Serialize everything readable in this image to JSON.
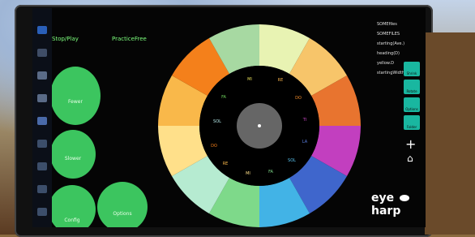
{
  "menu": {
    "stop_play": "Stop/Play",
    "practice_free": "PracticeFree"
  },
  "buttons": {
    "fewer": "Fewer",
    "slower": "Slower",
    "config": "Config",
    "options": "Options"
  },
  "wheel": {
    "inner_labels": [
      "FA",
      "MI",
      "RE",
      "DO",
      "TI",
      "LA",
      "SOL",
      "FA",
      "MI",
      "RE",
      "DO",
      "SOL"
    ],
    "colors": [
      "#b3e6e6",
      "#a7d9a2",
      "#e8f3b3",
      "#f7c56a",
      "#e8742f",
      "#c23fbf",
      "#3f66cc",
      "#42b3e6",
      "#7ed98a",
      "#b6ebd1",
      "#ffe08a",
      "#f9b84a",
      "#f4801b",
      "#000000"
    ]
  },
  "list": {
    "items": [
      "SOMEfiles",
      "SOMEFILES",
      "starting(Ave.)",
      "heading(D)",
      "yellow.D",
      "startingWidthfield.16"
    ]
  },
  "side_tools": [
    {
      "label": "Shrink",
      "icon": "search-icon"
    },
    {
      "label": "Rotate",
      "icon": "refresh-icon"
    },
    {
      "label": "Options",
      "icon": "key-icon"
    },
    {
      "label": "Folder",
      "icon": "folder-icon"
    },
    {
      "label": "Add",
      "icon": "plus-icon"
    },
    {
      "label": "Home",
      "icon": "home-icon"
    }
  ],
  "logo": {
    "left": "eye",
    "right": "harp"
  }
}
